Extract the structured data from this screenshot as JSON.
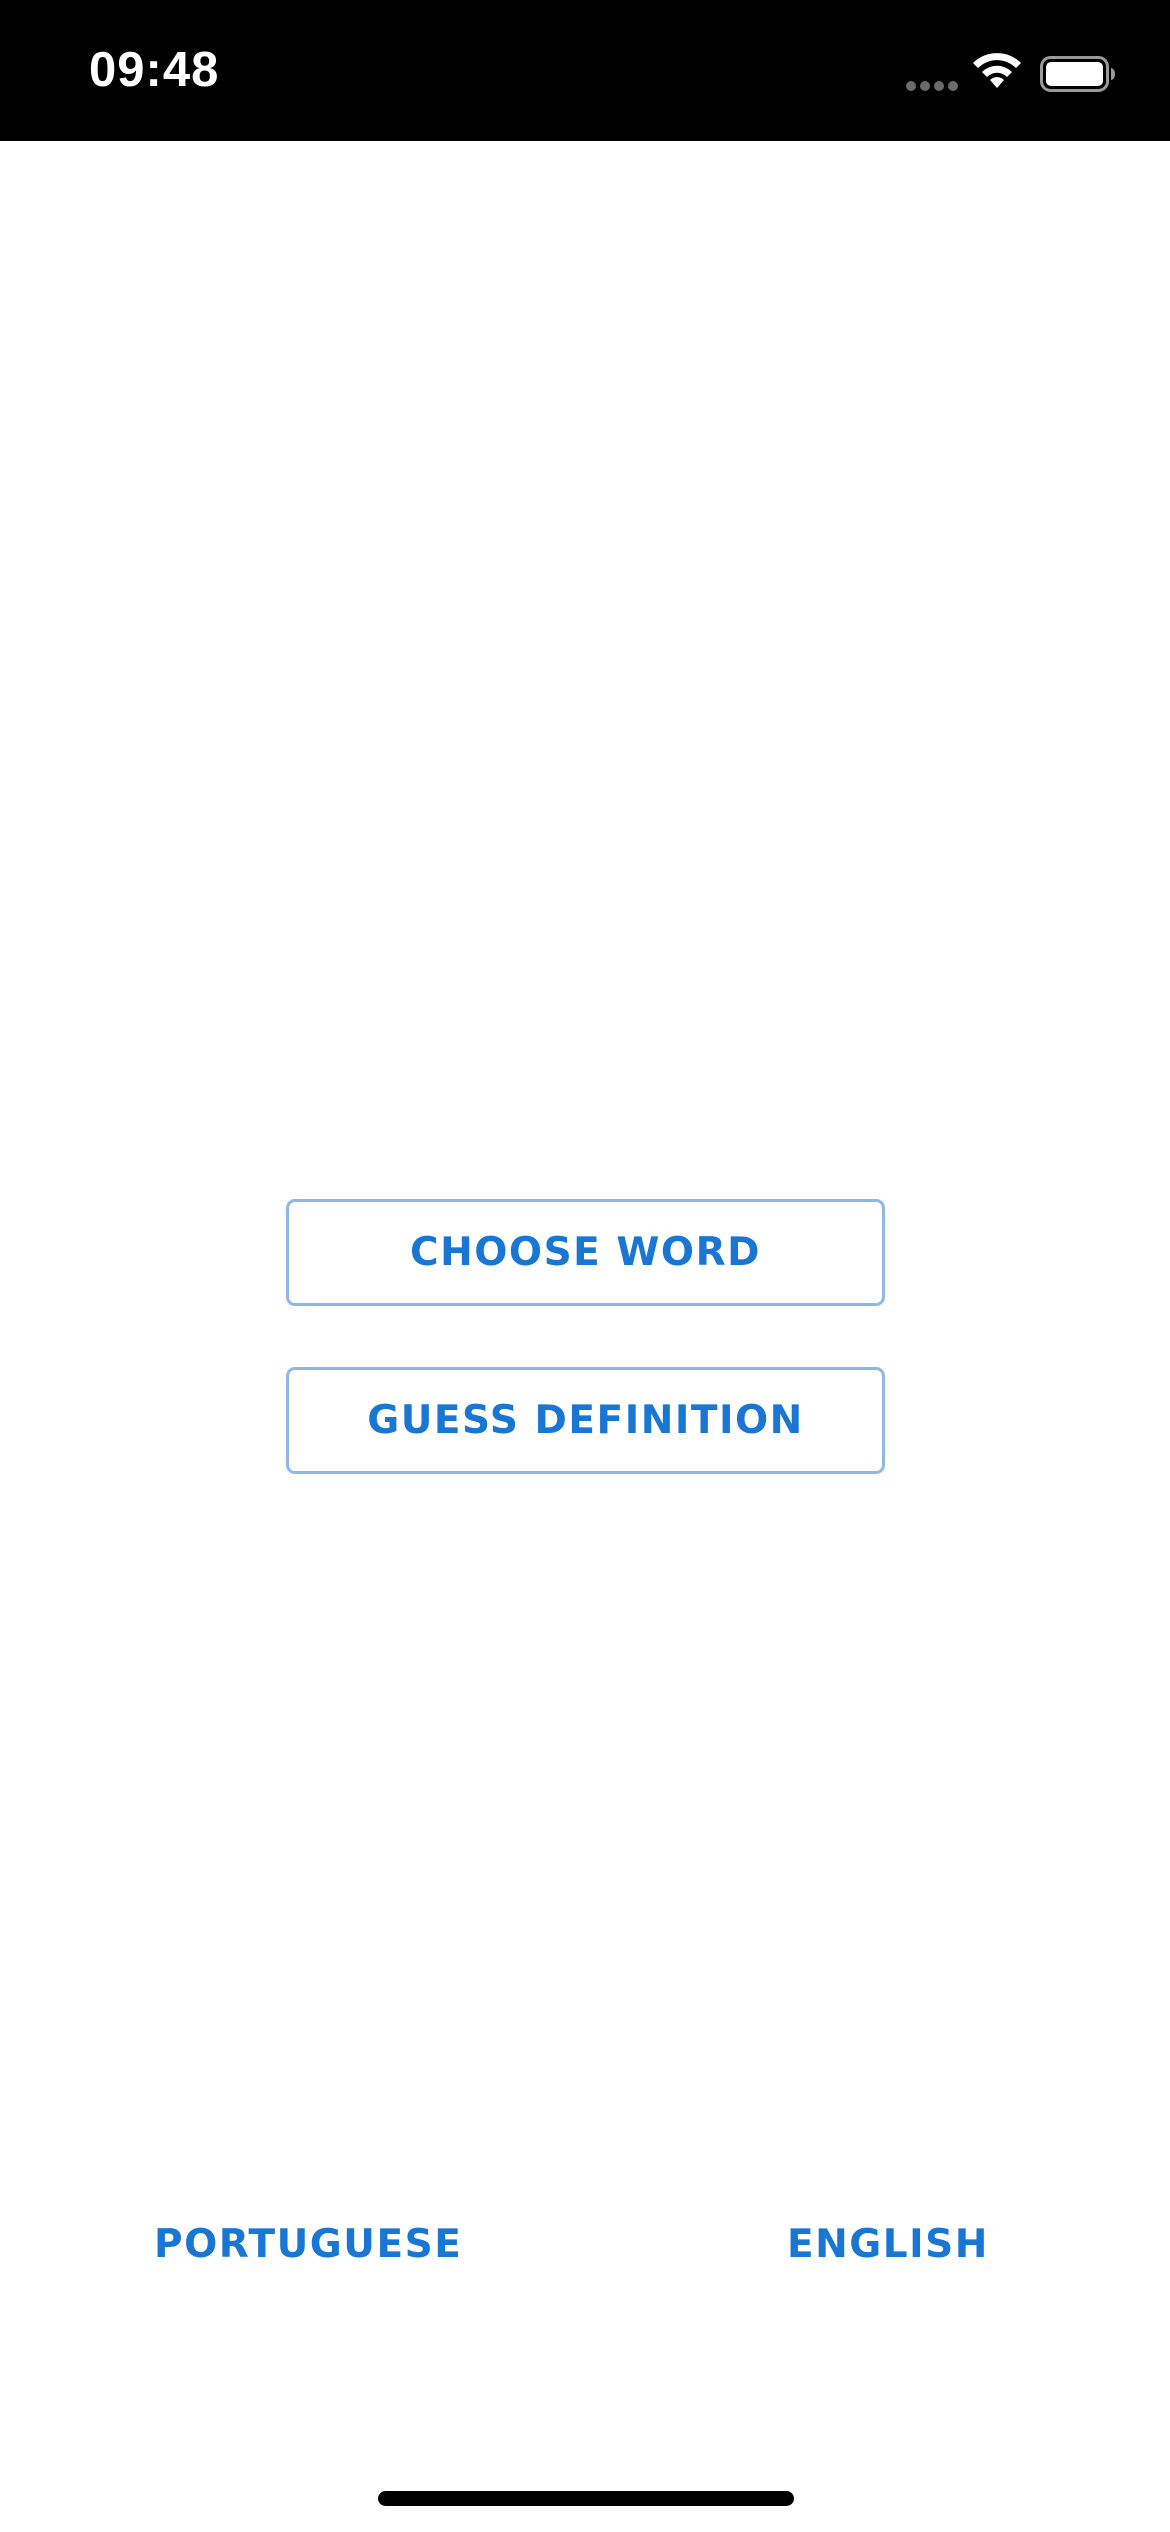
{
  "status_bar": {
    "time": "09:48",
    "icons": [
      "signal-dots-icon",
      "wifi-icon",
      "battery-icon"
    ]
  },
  "main": {
    "choose_word_label": "CHOOSE WORD",
    "guess_definition_label": "GUESS DEFINITION"
  },
  "language_bar": {
    "portuguese_label": "PORTUGUESE",
    "english_label": "ENGLISH"
  },
  "colors": {
    "accent": "#1976d2",
    "button_border": "#8fb8e6",
    "status_bar_bg": "#000000",
    "background": "#ffffff"
  }
}
